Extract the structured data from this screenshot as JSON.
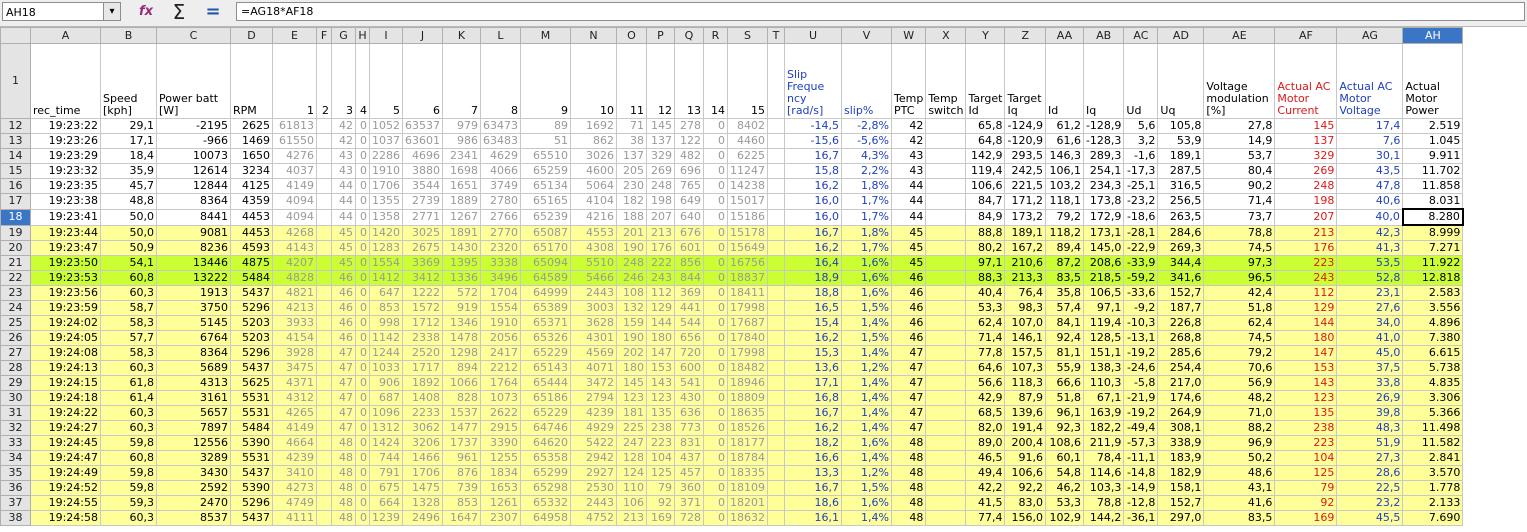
{
  "formula_bar": {
    "name_box": "AH18",
    "formula": "=AG18*AF18",
    "dropdown_icon": "▾",
    "fx_icon": "fx",
    "sum_icon": "Σ",
    "equals_icon": "="
  },
  "columns": [
    "A",
    "B",
    "C",
    "D",
    "E",
    "F",
    "G",
    "H",
    "I",
    "J",
    "K",
    "L",
    "M",
    "N",
    "O",
    "P",
    "Q",
    "R",
    "S",
    "T",
    "U",
    "V",
    "W",
    "X",
    "Y",
    "Z",
    "AA",
    "AB",
    "AC",
    "AD",
    "AE",
    "AF",
    "AG",
    "AH"
  ],
  "header_row_number": "1",
  "headers": [
    "rec_time",
    "Speed [kph]",
    "Power batt [W]",
    "RPM",
    "1",
    "2",
    "3",
    "4",
    "5",
    "6",
    "7",
    "8",
    "9",
    "10",
    "11",
    "12",
    "13",
    "14",
    "15",
    "",
    "Slip Freque ncy [rad/s]",
    "slip%",
    "Temp PTC",
    "Temp switch",
    "Target Id",
    "Target Iq",
    "Id",
    "Iq",
    "Ud",
    "Uq",
    "Voltage modulation [%]",
    "Actual AC Motor Current",
    "Actual AC Motor Voltage",
    "Actual Motor Power"
  ],
  "selected_cell": {
    "row": "18",
    "col": "AH"
  },
  "rows": [
    {
      "n": "12",
      "fill": "none",
      "cells": [
        "19:23:22",
        "29,1",
        "-2195",
        "2625",
        "61813",
        "",
        "42",
        "0",
        "1052",
        "63537",
        "979",
        "63473",
        "89",
        "1692",
        "71",
        "145",
        "278",
        "0",
        "8402",
        "",
        "-14,5",
        "-2,8%",
        "42",
        "",
        "65,8",
        "-124,9",
        "61,2",
        "-128,9",
        "5,6",
        "105,8",
        "27,8",
        "145",
        "17,4",
        "2.519"
      ]
    },
    {
      "n": "13",
      "fill": "none",
      "cells": [
        "19:23:26",
        "17,1",
        "-966",
        "1469",
        "61550",
        "",
        "42",
        "0",
        "1037",
        "63601",
        "986",
        "63483",
        "51",
        "862",
        "38",
        "137",
        "122",
        "0",
        "4460",
        "",
        "-15,6",
        "-5,6%",
        "42",
        "",
        "64,8",
        "-120,9",
        "61,6",
        "-128,3",
        "3,2",
        "53,9",
        "14,9",
        "137",
        "7,6",
        "1.045"
      ]
    },
    {
      "n": "14",
      "fill": "none",
      "cells": [
        "19:23:29",
        "18,4",
        "10073",
        "1650",
        "4276",
        "",
        "43",
        "0",
        "2286",
        "4696",
        "2341",
        "4629",
        "65510",
        "3026",
        "137",
        "329",
        "482",
        "0",
        "6225",
        "",
        "16,7",
        "4,3%",
        "43",
        "",
        "142,9",
        "293,5",
        "146,3",
        "289,3",
        "-1,6",
        "189,1",
        "53,7",
        "329",
        "30,1",
        "9.911"
      ]
    },
    {
      "n": "15",
      "fill": "none",
      "cells": [
        "19:23:32",
        "35,9",
        "12614",
        "3234",
        "4037",
        "",
        "43",
        "0",
        "1910",
        "3880",
        "1698",
        "4066",
        "65259",
        "4600",
        "205",
        "269",
        "696",
        "0",
        "11247",
        "",
        "15,8",
        "2,2%",
        "43",
        "",
        "119,4",
        "242,5",
        "106,1",
        "254,1",
        "-17,3",
        "287,5",
        "80,4",
        "269",
        "43,5",
        "11.702"
      ]
    },
    {
      "n": "16",
      "fill": "none",
      "cells": [
        "19:23:35",
        "45,7",
        "12844",
        "4125",
        "4149",
        "",
        "44",
        "0",
        "1706",
        "3544",
        "1651",
        "3749",
        "65134",
        "5064",
        "230",
        "248",
        "765",
        "0",
        "14238",
        "",
        "16,2",
        "1,8%",
        "44",
        "",
        "106,6",
        "221,5",
        "103,2",
        "234,3",
        "-25,1",
        "316,5",
        "90,2",
        "248",
        "47,8",
        "11.858"
      ]
    },
    {
      "n": "17",
      "fill": "none",
      "cells": [
        "19:23:38",
        "48,8",
        "8364",
        "4359",
        "4094",
        "",
        "44",
        "0",
        "1355",
        "2739",
        "1889",
        "2780",
        "65165",
        "4104",
        "182",
        "198",
        "649",
        "0",
        "15017",
        "",
        "16,0",
        "1,7%",
        "44",
        "",
        "84,7",
        "171,2",
        "118,1",
        "173,8",
        "-23,2",
        "256,5",
        "71,4",
        "198",
        "40,6",
        "8.031"
      ]
    },
    {
      "n": "18",
      "fill": "none",
      "cells": [
        "19:23:41",
        "50,0",
        "8441",
        "4453",
        "4094",
        "",
        "44",
        "0",
        "1358",
        "2771",
        "1267",
        "2766",
        "65239",
        "4216",
        "188",
        "207",
        "640",
        "0",
        "15186",
        "",
        "16,0",
        "1,7%",
        "44",
        "",
        "84,9",
        "173,2",
        "79,2",
        "172,9",
        "-18,6",
        "263,5",
        "73,7",
        "207",
        "40,0",
        "8.280"
      ]
    },
    {
      "n": "19",
      "fill": "yellow",
      "cells": [
        "19:23:44",
        "50,0",
        "9081",
        "4453",
        "4268",
        "",
        "45",
        "0",
        "1420",
        "3025",
        "1891",
        "2770",
        "65087",
        "4553",
        "201",
        "213",
        "676",
        "0",
        "15178",
        "",
        "16,7",
        "1,8%",
        "45",
        "",
        "88,8",
        "189,1",
        "118,2",
        "173,1",
        "-28,1",
        "284,6",
        "78,8",
        "213",
        "42,3",
        "8.999"
      ]
    },
    {
      "n": "20",
      "fill": "yellow",
      "cells": [
        "19:23:47",
        "50,9",
        "8236",
        "4593",
        "4143",
        "",
        "45",
        "0",
        "1283",
        "2675",
        "1430",
        "2320",
        "65170",
        "4308",
        "190",
        "176",
        "601",
        "0",
        "15649",
        "",
        "16,2",
        "1,7%",
        "45",
        "",
        "80,2",
        "167,2",
        "89,4",
        "145,0",
        "-22,9",
        "269,3",
        "74,5",
        "176",
        "41,3",
        "7.271"
      ]
    },
    {
      "n": "21",
      "fill": "lime",
      "cells": [
        "19:23:50",
        "54,1",
        "13446",
        "4875",
        "4207",
        "",
        "45",
        "0",
        "1554",
        "3369",
        "1395",
        "3338",
        "65094",
        "5510",
        "248",
        "222",
        "856",
        "0",
        "16756",
        "",
        "16,4",
        "1,6%",
        "45",
        "",
        "97,1",
        "210,6",
        "87,2",
        "208,6",
        "-33,9",
        "344,4",
        "97,3",
        "223",
        "53,5",
        "11.922"
      ]
    },
    {
      "n": "22",
      "fill": "lime",
      "cells": [
        "19:23:53",
        "60,8",
        "13222",
        "5484",
        "4828",
        "",
        "46",
        "0",
        "1412",
        "3412",
        "1336",
        "3496",
        "64589",
        "5466",
        "246",
        "243",
        "844",
        "0",
        "18837",
        "",
        "18,9",
        "1,6%",
        "46",
        "",
        "88,3",
        "213,3",
        "83,5",
        "218,5",
        "-59,2",
        "341,6",
        "96,5",
        "243",
        "52,8",
        "12.818"
      ]
    },
    {
      "n": "23",
      "fill": "yellow",
      "cells": [
        "19:23:56",
        "60,3",
        "1913",
        "5437",
        "4821",
        "",
        "46",
        "0",
        "647",
        "1222",
        "572",
        "1704",
        "64999",
        "2443",
        "108",
        "112",
        "369",
        "0",
        "18411",
        "",
        "18,8",
        "1,6%",
        "46",
        "",
        "40,4",
        "76,4",
        "35,8",
        "106,5",
        "-33,6",
        "152,7",
        "42,4",
        "112",
        "23,1",
        "2.583"
      ]
    },
    {
      "n": "24",
      "fill": "yellow",
      "cells": [
        "19:23:59",
        "58,7",
        "3750",
        "5296",
        "4213",
        "",
        "46",
        "0",
        "853",
        "1572",
        "919",
        "1554",
        "65389",
        "3003",
        "132",
        "129",
        "441",
        "0",
        "17998",
        "",
        "16,5",
        "1,5%",
        "46",
        "",
        "53,3",
        "98,3",
        "57,4",
        "97,1",
        "-9,2",
        "187,7",
        "51,8",
        "129",
        "27,6",
        "3.556"
      ]
    },
    {
      "n": "25",
      "fill": "yellow",
      "cells": [
        "19:24:02",
        "58,3",
        "5145",
        "5203",
        "3933",
        "",
        "46",
        "0",
        "998",
        "1712",
        "1346",
        "1910",
        "65371",
        "3628",
        "159",
        "144",
        "544",
        "0",
        "17687",
        "",
        "15,4",
        "1,4%",
        "46",
        "",
        "62,4",
        "107,0",
        "84,1",
        "119,4",
        "-10,3",
        "226,8",
        "62,4",
        "144",
        "34,0",
        "4.896"
      ]
    },
    {
      "n": "26",
      "fill": "yellow",
      "cells": [
        "19:24:05",
        "57,7",
        "6764",
        "5203",
        "4154",
        "",
        "46",
        "0",
        "1142",
        "2338",
        "1478",
        "2056",
        "65326",
        "4301",
        "190",
        "180",
        "656",
        "0",
        "17840",
        "",
        "16,2",
        "1,5%",
        "46",
        "",
        "71,4",
        "146,1",
        "92,4",
        "128,5",
        "-13,1",
        "268,8",
        "74,5",
        "180",
        "41,0",
        "7.380"
      ]
    },
    {
      "n": "27",
      "fill": "yellow",
      "cells": [
        "19:24:08",
        "58,3",
        "8364",
        "5296",
        "3928",
        "",
        "47",
        "0",
        "1244",
        "2520",
        "1298",
        "2417",
        "65229",
        "4569",
        "202",
        "147",
        "720",
        "0",
        "17998",
        "",
        "15,3",
        "1,4%",
        "47",
        "",
        "77,8",
        "157,5",
        "81,1",
        "151,1",
        "-19,2",
        "285,6",
        "79,2",
        "147",
        "45,0",
        "6.615"
      ]
    },
    {
      "n": "28",
      "fill": "yellow",
      "cells": [
        "19:24:13",
        "60,3",
        "5689",
        "5437",
        "3475",
        "",
        "47",
        "0",
        "1033",
        "1717",
        "894",
        "2212",
        "65143",
        "4071",
        "180",
        "153",
        "600",
        "0",
        "18482",
        "",
        "13,6",
        "1,2%",
        "47",
        "",
        "64,6",
        "107,3",
        "55,9",
        "138,3",
        "-24,6",
        "254,4",
        "70,6",
        "153",
        "37,5",
        "5.738"
      ]
    },
    {
      "n": "29",
      "fill": "yellow",
      "cells": [
        "19:24:15",
        "61,8",
        "4313",
        "5625",
        "4371",
        "",
        "47",
        "0",
        "906",
        "1892",
        "1066",
        "1764",
        "65444",
        "3472",
        "145",
        "143",
        "541",
        "0",
        "18946",
        "",
        "17,1",
        "1,4%",
        "47",
        "",
        "56,6",
        "118,3",
        "66,6",
        "110,3",
        "-5,8",
        "217,0",
        "56,9",
        "143",
        "33,8",
        "4.835"
      ]
    },
    {
      "n": "30",
      "fill": "yellow",
      "cells": [
        "19:24:18",
        "61,4",
        "3161",
        "5531",
        "4312",
        "",
        "47",
        "0",
        "687",
        "1408",
        "828",
        "1073",
        "65186",
        "2794",
        "123",
        "123",
        "430",
        "0",
        "18809",
        "",
        "16,8",
        "1,4%",
        "47",
        "",
        "42,9",
        "87,9",
        "51,8",
        "67,1",
        "-21,9",
        "174,6",
        "48,2",
        "123",
        "26,9",
        "3.306"
      ]
    },
    {
      "n": "31",
      "fill": "yellow",
      "cells": [
        "19:24:22",
        "60,3",
        "5657",
        "5531",
        "4265",
        "",
        "47",
        "0",
        "1096",
        "2233",
        "1537",
        "2622",
        "65229",
        "4239",
        "181",
        "135",
        "636",
        "0",
        "18635",
        "",
        "16,7",
        "1,4%",
        "47",
        "",
        "68,5",
        "139,6",
        "96,1",
        "163,9",
        "-19,2",
        "264,9",
        "71,0",
        "135",
        "39,8",
        "5.366"
      ]
    },
    {
      "n": "32",
      "fill": "yellow",
      "cells": [
        "19:24:27",
        "60,3",
        "7897",
        "5484",
        "4149",
        "",
        "47",
        "0",
        "1312",
        "3062",
        "1477",
        "2915",
        "64746",
        "4929",
        "225",
        "238",
        "773",
        "0",
        "18526",
        "",
        "16,2",
        "1,4%",
        "47",
        "",
        "82,0",
        "191,4",
        "92,3",
        "182,2",
        "-49,4",
        "308,1",
        "88,2",
        "238",
        "48,3",
        "11.498"
      ]
    },
    {
      "n": "33",
      "fill": "yellow",
      "cells": [
        "19:24:45",
        "59,8",
        "12556",
        "5390",
        "4664",
        "",
        "48",
        "0",
        "1424",
        "3206",
        "1737",
        "3390",
        "64620",
        "5422",
        "247",
        "223",
        "831",
        "0",
        "18177",
        "",
        "18,2",
        "1,6%",
        "48",
        "",
        "89,0",
        "200,4",
        "108,6",
        "211,9",
        "-57,3",
        "338,9",
        "96,9",
        "223",
        "51,9",
        "11.582"
      ]
    },
    {
      "n": "34",
      "fill": "yellow",
      "cells": [
        "19:24:47",
        "60,8",
        "3289",
        "5531",
        "4239",
        "",
        "48",
        "0",
        "744",
        "1466",
        "961",
        "1255",
        "65358",
        "2942",
        "128",
        "104",
        "437",
        "0",
        "18784",
        "",
        "16,6",
        "1,4%",
        "48",
        "",
        "46,5",
        "91,6",
        "60,1",
        "78,4",
        "-11,1",
        "183,9",
        "50,2",
        "104",
        "27,3",
        "2.841"
      ]
    },
    {
      "n": "35",
      "fill": "yellow",
      "cells": [
        "19:24:49",
        "59,8",
        "3430",
        "5437",
        "3410",
        "",
        "48",
        "0",
        "791",
        "1706",
        "876",
        "1834",
        "65299",
        "2927",
        "124",
        "125",
        "457",
        "0",
        "18335",
        "",
        "13,3",
        "1,2%",
        "48",
        "",
        "49,4",
        "106,6",
        "54,8",
        "114,6",
        "-14,8",
        "182,9",
        "48,6",
        "125",
        "28,6",
        "3.570"
      ]
    },
    {
      "n": "36",
      "fill": "yellow",
      "cells": [
        "19:24:52",
        "59,8",
        "2592",
        "5390",
        "4273",
        "",
        "48",
        "0",
        "675",
        "1475",
        "739",
        "1653",
        "65298",
        "2530",
        "110",
        "79",
        "360",
        "0",
        "18109",
        "",
        "16,7",
        "1,5%",
        "48",
        "",
        "42,2",
        "92,2",
        "46,2",
        "103,3",
        "-14,9",
        "158,1",
        "43,1",
        "79",
        "22,5",
        "1.778"
      ]
    },
    {
      "n": "37",
      "fill": "yellow",
      "cells": [
        "19:24:55",
        "59,3",
        "2470",
        "5296",
        "4749",
        "",
        "48",
        "0",
        "664",
        "1328",
        "853",
        "1261",
        "65332",
        "2443",
        "106",
        "92",
        "371",
        "0",
        "18201",
        "",
        "18,6",
        "1,6%",
        "48",
        "",
        "41,5",
        "83,0",
        "53,3",
        "78,8",
        "-12,8",
        "152,7",
        "41,6",
        "92",
        "23,2",
        "2.133"
      ]
    },
    {
      "n": "38",
      "fill": "yellow",
      "cells": [
        "19:24:58",
        "60,3",
        "8537",
        "5437",
        "4111",
        "",
        "48",
        "0",
        "1239",
        "2496",
        "1647",
        "2307",
        "64958",
        "4752",
        "213",
        "169",
        "728",
        "0",
        "18632",
        "",
        "16,1",
        "1,4%",
        "48",
        "",
        "77,4",
        "156,0",
        "102,9",
        "144,2",
        "-36,1",
        "297,0",
        "83,5",
        "169",
        "45,5",
        "7.690"
      ]
    }
  ]
}
